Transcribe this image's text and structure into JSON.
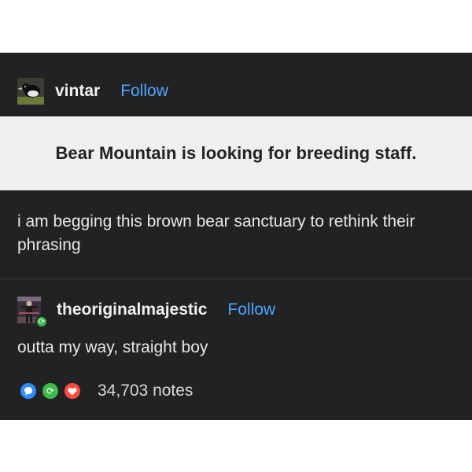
{
  "post": {
    "username": "vintar",
    "follow_label": "Follow",
    "quote": "Bear Mountain is looking for breeding staff.",
    "body": "i am begging this brown bear sanctuary to rethink their phrasing"
  },
  "reblog": {
    "username": "theoriginalmajestic",
    "follow_label": "Follow",
    "body": "outta my way, straight boy"
  },
  "notes": {
    "count_label": "34,703 notes"
  },
  "colors": {
    "card_background": "#222224",
    "follow_link": "#4ea6ff",
    "reply_dot": "#2f8dff",
    "reblog_dot": "#3fbb4d",
    "like_dot": "#ff4a3d"
  },
  "icons": {
    "avatar_1": "bird-avatar",
    "avatar_2": "figure-avatar",
    "reblog_badge": "reblog-icon",
    "reply": "speech-bubble-icon",
    "reblog": "reblog-icon",
    "like": "heart-icon"
  }
}
